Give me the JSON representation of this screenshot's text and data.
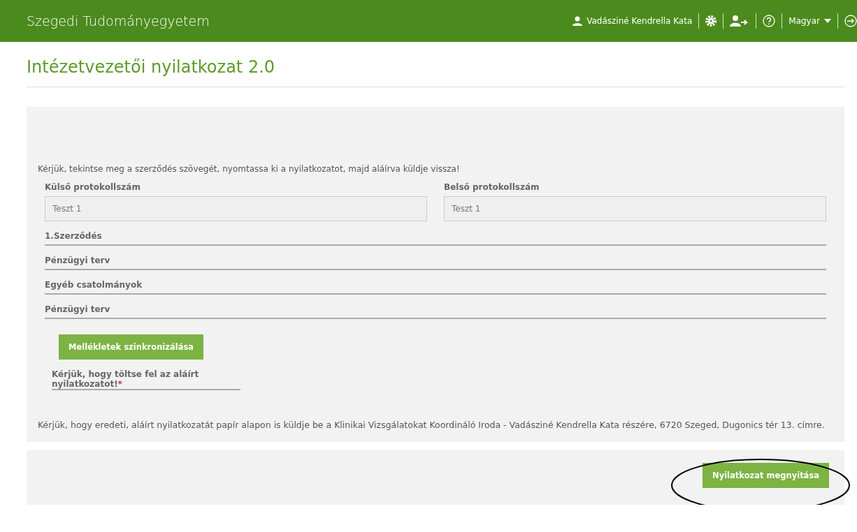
{
  "header": {
    "brand": "Szegedi Tudományegyetem",
    "user": "Vadásziné Kendrella Kata",
    "language": "Magyar"
  },
  "page_title": "Intézetvezetői nyilatkozat 2.0",
  "intro": "Kérjük, tekintse meg a szerződés szövegét, nyomtassa ki a nyilatkozatot, majd aláírva küldje vissza!",
  "fields": [
    {
      "label": "Külső protokollszám",
      "value": "Teszt 1"
    },
    {
      "label": "Belső protokollszám",
      "value": "Teszt 1"
    }
  ],
  "sections": [
    {
      "label": "1.Szerződés"
    },
    {
      "label": "Pénzügyi terv"
    },
    {
      "label": "Egyéb csatolmányok"
    },
    {
      "label": "Pénzügyi terv"
    }
  ],
  "sync_button": "Mellékletek szinkronizálása",
  "upload": {
    "label": "Kérjük, hogy töltse fel az aláírt nyilatkozatot!",
    "required_mark": "*"
  },
  "note": "Kérjük, hogy eredeti, aláírt nyilatkozatát papír alapon is küldje be a Klinikai Vizsgálatokat Koordináló Iroda - Vadásziné Kendrella Kata részére, 6720 Szeged, Dugonics tér 13. címre.",
  "open_button": "Nyilatkozat megnyitása"
}
